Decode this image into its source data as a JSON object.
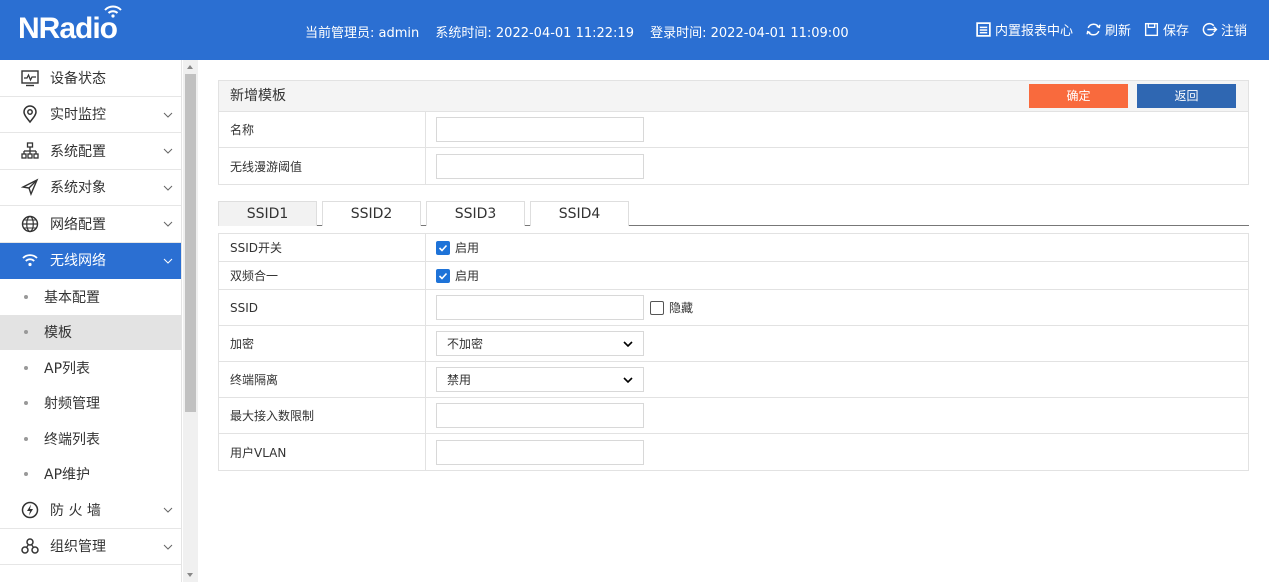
{
  "header": {
    "logo": "NRadio",
    "admin": "当前管理员: admin",
    "system_time": "系统时间: 2022-04-01 11:22:19",
    "login_time": "登录时间: 2022-04-01 11:09:00",
    "actions": [
      "内置报表中心",
      "刷新",
      "保存",
      "注销"
    ]
  },
  "sidebar": {
    "items": [
      {
        "label": "设备状态"
      },
      {
        "label": "实时监控"
      },
      {
        "label": "系统配置"
      },
      {
        "label": "系统对象"
      },
      {
        "label": "网络配置"
      },
      {
        "label": "无线网络"
      }
    ],
    "sub_items": [
      "基本配置",
      "模板",
      "AP列表",
      "射频管理",
      "终端列表",
      "AP维护"
    ],
    "items_after": [
      {
        "label": "防 火 墙"
      },
      {
        "label": "组织管理"
      }
    ]
  },
  "form": {
    "title": "新增模板",
    "ok": "确定",
    "back": "返回",
    "name_label": "名称",
    "roam_label": "无线漫游阈值"
  },
  "tabs": [
    "SSID1",
    "SSID2",
    "SSID3",
    "SSID4"
  ],
  "ssid": {
    "switch_label": "SSID开关",
    "switch_value": "启用",
    "dual_label": "双频合一",
    "dual_value": "启用",
    "ssid_label": "SSID",
    "hidden_label": "隐藏",
    "encrypt_label": "加密",
    "encrypt_value": "不加密",
    "isolate_label": "终端隔离",
    "isolate_value": "禁用",
    "max_label": "最大接入数限制",
    "vlan_label": "用户VLAN"
  },
  "colors": {
    "header_blue": "#2b6fd2",
    "ok_orange": "#f96a3d",
    "back_blue": "#2f67b2"
  }
}
